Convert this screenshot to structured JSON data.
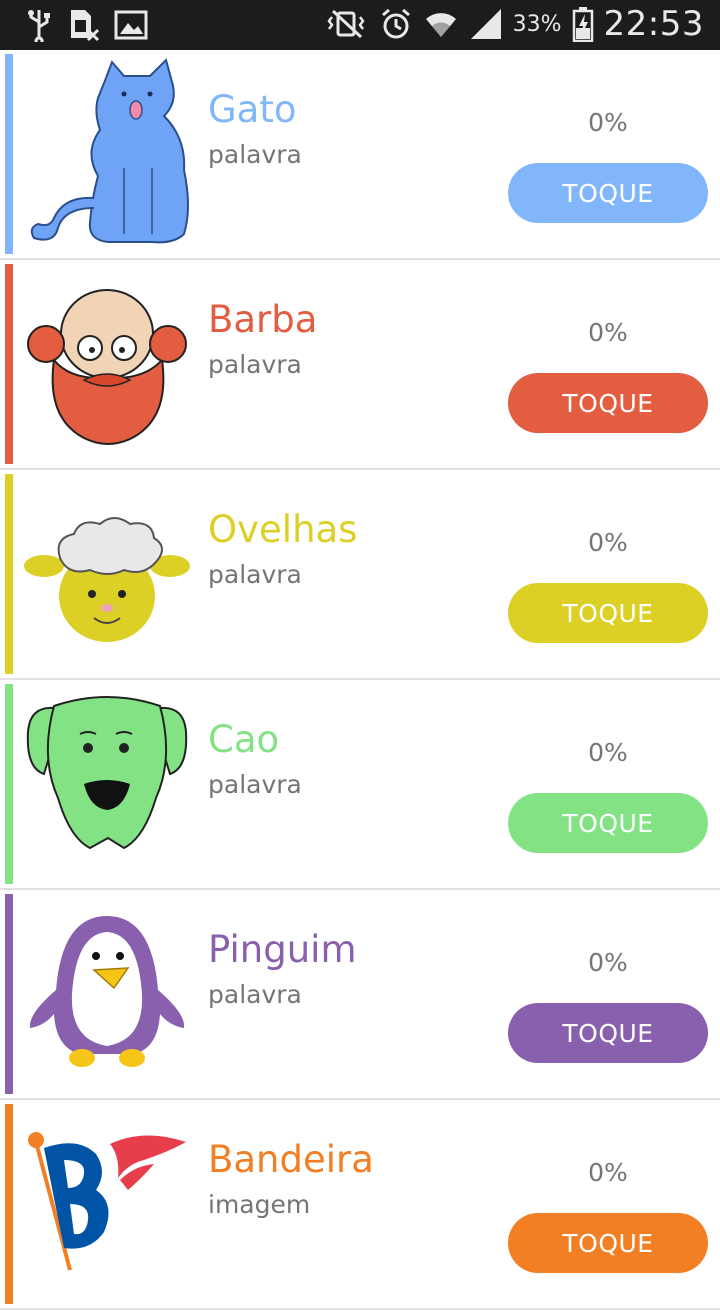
{
  "status_bar": {
    "icons_left": [
      "usb-icon",
      "sim-card-icon",
      "image-icon"
    ],
    "icons_right": [
      "vibrate-mute-icon",
      "alarm-icon",
      "wifi-icon",
      "signal-icon",
      "battery-charging-icon"
    ],
    "battery": "33%",
    "time": "22:53"
  },
  "items": [
    {
      "title": "Gato",
      "subtitle": "palavra",
      "percent": "0%",
      "button": "TOQUE",
      "color": "#82b6fb",
      "image": "cat-image"
    },
    {
      "title": "Barba",
      "subtitle": "palavra",
      "percent": "0%",
      "button": "TOQUE",
      "color": "#e35d40",
      "image": "bearded-man-image"
    },
    {
      "title": "Ovelhas",
      "subtitle": "palavra",
      "percent": "0%",
      "button": "TOQUE",
      "color": "#dcd026",
      "image": "sheep-image"
    },
    {
      "title": "Cao",
      "subtitle": "palavra",
      "percent": "0%",
      "button": "TOQUE",
      "color": "#82e284",
      "image": "dog-image"
    },
    {
      "title": "Pinguim",
      "subtitle": "palavra",
      "percent": "0%",
      "button": "TOQUE",
      "color": "#8960ad",
      "image": "penguin-image"
    },
    {
      "title": "Bandeira",
      "subtitle": "imagem",
      "percent": "0%",
      "button": "TOQUE",
      "color": "#f27f23",
      "image": "flag-image"
    }
  ]
}
